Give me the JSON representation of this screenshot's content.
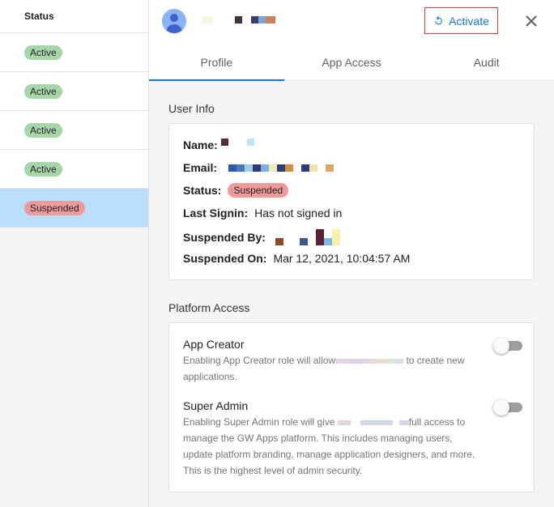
{
  "list": {
    "header": "Status",
    "rows": [
      {
        "status": "Active",
        "selected": false
      },
      {
        "status": "Active",
        "selected": false
      },
      {
        "status": "Active",
        "selected": false
      },
      {
        "status": "Active",
        "selected": false
      },
      {
        "status": "Suspended",
        "selected": true
      }
    ]
  },
  "header": {
    "avatar_icon": "person-avatar-icon",
    "activate_label": "Activate",
    "activate_icon": "refresh-icon",
    "close_icon": "close-icon"
  },
  "tabs": [
    {
      "label": "Profile",
      "active": true
    },
    {
      "label": "App Access",
      "active": false
    },
    {
      "label": "Audit",
      "active": false
    }
  ],
  "user_info": {
    "title": "User Info",
    "name_label": "Name:",
    "email_label": "Email:",
    "status_label": "Status:",
    "status_value": "Suspended",
    "last_signin_label": "Last Signin:",
    "last_signin_value": "Has not signed in",
    "suspended_by_label": "Suspended By:",
    "suspended_on_label": "Suspended On:",
    "suspended_on_value": "Mar 12, 2021, 10:04:57 AM"
  },
  "platform_access": {
    "title": "Platform Access",
    "app_creator": {
      "title": "App Creator",
      "desc_before": "Enabling App Creator role will allow",
      "desc_after": "to create new applications.",
      "enabled": false
    },
    "super_admin": {
      "title": "Super Admin",
      "desc_before": "Enabling Super Admin role will give",
      "desc_after": "full access to manage the GW Apps platform. This includes managing users, update platform branding, manage application designers, and more. This is the highest level of admin security.",
      "enabled": false
    }
  },
  "colors": {
    "accent": "#1976d2",
    "active_chip": "#a5d6a7",
    "suspended_chip": "#ef9a9a",
    "selected_row": "#bbdefb",
    "activate_border": "#e53935"
  }
}
